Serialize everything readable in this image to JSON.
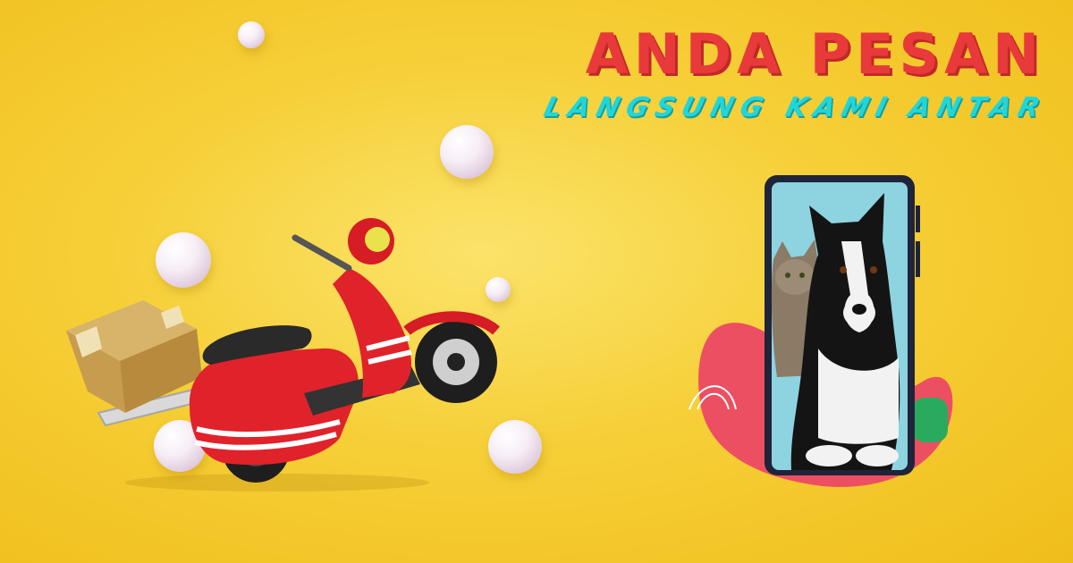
{
  "headline": {
    "title": "ANDA PESAN",
    "subtitle": "LANGSUNG KAMI ANTAR"
  },
  "colors": {
    "background": "#f6cf37",
    "title": "#e83a3a",
    "subtitle": "#22d6d8",
    "scooter": "#e0222a",
    "phone_screen": "#8ed3e0"
  },
  "illustrations": {
    "scooter": "red-scooter-with-cardboard-box",
    "phone": "smartphone-showing-dog-and-cat",
    "decor": "pearl-spheres"
  }
}
